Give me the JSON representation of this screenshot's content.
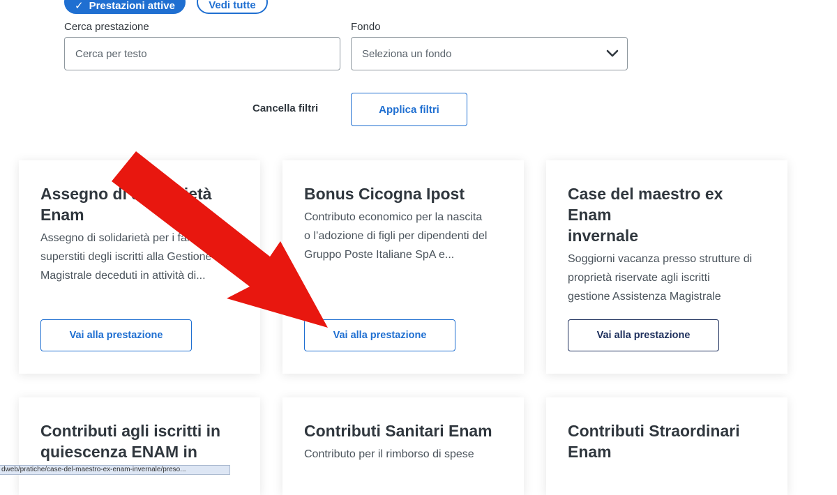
{
  "filters": {
    "active_tab_label": "Prestazioni attive",
    "all_tab_label": "Vedi tutte",
    "search_label": "Cerca prestazione",
    "search_placeholder": "Cerca per testo",
    "fund_label": "Fondo",
    "fund_selected": "Seleziona un fondo",
    "clear_label": "Cancella filtri",
    "apply_label": "Applica filtri"
  },
  "cards": [
    {
      "title_lines": [
        "Assegno di solidarietà",
        "Enam"
      ],
      "desc_lines": [
        "Assegno di solidarietà per i familiari",
        "superstiti degli iscritti alla Gestione",
        "Magistrale deceduti in attività di..."
      ],
      "button_label": "Vai alla prestazione"
    },
    {
      "title_lines": [
        "Bonus Cicogna Ipost"
      ],
      "desc_lines": [
        "Contributo economico per la nascita",
        "o l’adozione di figli per dipendenti del",
        "Gruppo Poste Italiane SpA e..."
      ],
      "button_label": "Vai alla prestazione"
    },
    {
      "title_lines": [
        "Case del maestro ex Enam",
        "invernale"
      ],
      "desc_lines": [
        "Soggiorni vacanza presso strutture di",
        "proprietà riservate agli iscritti",
        "gestione Assistenza Magistrale"
      ],
      "button_label": "Vai alla prestazione"
    },
    {
      "title_lines": [
        "Contributi agli iscritti in",
        "quiescenza ENAM in"
      ],
      "desc_lines": [],
      "button_label": ""
    },
    {
      "title_lines": [
        "Contributi Sanitari Enam"
      ],
      "desc_lines": [
        "Contributo per il rimborso di spese"
      ],
      "button_label": ""
    },
    {
      "title_lines": [
        "Contributi Straordinari",
        "Enam"
      ],
      "desc_lines": [],
      "button_label": ""
    }
  ],
  "status_bar_url": "dweb/pratiche/case-del-maestro-ex-enam-invernale/preso...",
  "colors": {
    "accent": "#1f6fd1",
    "dark_button": "#1d2f5c",
    "annotation_arrow": "#e8170f"
  },
  "icons": {
    "check": "check-icon",
    "chevron": "chevron-down-icon"
  }
}
